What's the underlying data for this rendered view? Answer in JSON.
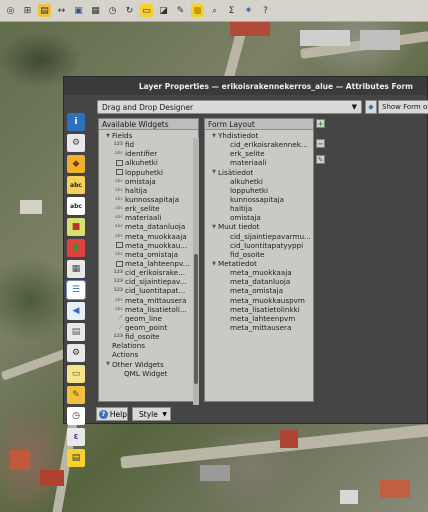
{
  "dialog": {
    "title": "Layer Properties — erikoisrakennekerros_alue — Attributes Form",
    "designer_mode": "Drag and Drop Designer",
    "show_form_label": "Show Form on",
    "help_label": "Help",
    "style_label": "Style"
  },
  "available_widgets": {
    "header": "Available Widgets",
    "rows": [
      {
        "kind": "group",
        "label": "Fields",
        "indent": 1
      },
      {
        "kind": "int",
        "label": "fid",
        "indent": 2
      },
      {
        "kind": "str",
        "label": "identifier",
        "indent": 2
      },
      {
        "kind": "date",
        "label": "alkuhetki",
        "indent": 2
      },
      {
        "kind": "date",
        "label": "loppuhetki",
        "indent": 2
      },
      {
        "kind": "str",
        "label": "omistaja",
        "indent": 2
      },
      {
        "kind": "str",
        "label": "haltija",
        "indent": 2
      },
      {
        "kind": "str",
        "label": "kunnossapitaja",
        "indent": 2
      },
      {
        "kind": "str",
        "label": "erk_selite",
        "indent": 2
      },
      {
        "kind": "str",
        "label": "materiaali",
        "indent": 2
      },
      {
        "kind": "str",
        "label": "meta_datanluoja",
        "indent": 2
      },
      {
        "kind": "str",
        "label": "meta_muokkaaja",
        "indent": 2
      },
      {
        "kind": "date",
        "label": "meta_muokkau...",
        "indent": 2
      },
      {
        "kind": "str",
        "label": "meta_omistaja",
        "indent": 2
      },
      {
        "kind": "date",
        "label": "meta_lahteenpv...",
        "indent": 2
      },
      {
        "kind": "int",
        "label": "cid_erikoisrake...",
        "indent": 2
      },
      {
        "kind": "int",
        "label": "cid_sijaintiepav...",
        "indent": 2
      },
      {
        "kind": "int",
        "label": "cid_luontitapat...",
        "indent": 2
      },
      {
        "kind": "str",
        "label": "meta_mittausera",
        "indent": 2
      },
      {
        "kind": "str",
        "label": "meta_lisatietoli...",
        "indent": 2
      },
      {
        "kind": "geom",
        "label": "geom_line",
        "indent": 2
      },
      {
        "kind": "geom",
        "label": "geom_point",
        "indent": 2
      },
      {
        "kind": "int",
        "label": "fid_osoite",
        "indent": 2
      },
      {
        "kind": "plain",
        "label": "Relations",
        "indent": 1
      },
      {
        "kind": "plain",
        "label": "Actions",
        "indent": 1
      },
      {
        "kind": "group",
        "label": "Other Widgets",
        "indent": 1
      },
      {
        "kind": "plain",
        "label": "QML Widget",
        "indent": 2
      }
    ]
  },
  "form_layout": {
    "header": "Form Layout",
    "rows": [
      {
        "kind": "group",
        "label": "Yhdistiedot",
        "indent": 1
      },
      {
        "kind": "plain",
        "label": "cid_erikoisrakennek...",
        "indent": 2
      },
      {
        "kind": "plain",
        "label": "erk_selite",
        "indent": 2
      },
      {
        "kind": "plain",
        "label": "materiaali",
        "indent": 2
      },
      {
        "kind": "group",
        "label": "Lisätiedot",
        "indent": 1
      },
      {
        "kind": "plain",
        "label": "alkuhetki",
        "indent": 2
      },
      {
        "kind": "plain",
        "label": "loppuhetki",
        "indent": 2
      },
      {
        "kind": "plain",
        "label": "kunnossapitaja",
        "indent": 2
      },
      {
        "kind": "plain",
        "label": "haltija",
        "indent": 2
      },
      {
        "kind": "plain",
        "label": "omistaja",
        "indent": 2
      },
      {
        "kind": "group",
        "label": "Muut tiedot",
        "indent": 1
      },
      {
        "kind": "plain",
        "label": "cid_sijaintiepavarmu...",
        "indent": 2
      },
      {
        "kind": "plain",
        "label": "cid_luontitapatyyppi",
        "indent": 2
      },
      {
        "kind": "plain",
        "label": "fid_osoite",
        "indent": 2
      },
      {
        "kind": "group",
        "label": "Metatiedot",
        "indent": 1
      },
      {
        "kind": "plain",
        "label": "meta_muokkaaja",
        "indent": 2
      },
      {
        "kind": "plain",
        "label": "meta_datanluoja",
        "indent": 2
      },
      {
        "kind": "plain",
        "label": "meta_omistaja",
        "indent": 2
      },
      {
        "kind": "plain",
        "label": "meta_muokkauspvm",
        "indent": 2
      },
      {
        "kind": "plain",
        "label": "meta_lisatietolinkki",
        "indent": 2
      },
      {
        "kind": "plain",
        "label": "meta_lahteenpvm",
        "indent": 2
      },
      {
        "kind": "plain",
        "label": "meta_mittausera",
        "indent": 2
      }
    ]
  },
  "side_icons": [
    {
      "name": "information-icon",
      "glyph": "i",
      "bg": "#2f6fbf",
      "fg": "#ffffff"
    },
    {
      "name": "source-icon",
      "glyph": "⚙",
      "bg": "#e8e8e8",
      "fg": "#444444"
    },
    {
      "name": "symbology-icon",
      "glyph": "◆",
      "bg": "#f0b030",
      "fg": "#7a3d00"
    },
    {
      "name": "labels-icon",
      "glyph": "abc",
      "bg": "#f5d05a",
      "fg": "#222222"
    },
    {
      "name": "masks-icon",
      "glyph": "abc",
      "bg": "#ffffff",
      "fg": "#222222"
    },
    {
      "name": "3d-view-icon",
      "glyph": "■",
      "bg": "#d8e070",
      "fg": "#c03030"
    },
    {
      "name": "diagrams-icon",
      "glyph": "▮",
      "bg": "#e04040",
      "fg": "#2a9a2a"
    },
    {
      "name": "fields-icon",
      "glyph": "▦",
      "bg": "#e8e8e8",
      "fg": "#444444"
    },
    {
      "name": "attributes-form-icon",
      "glyph": "☰",
      "bg": "#ffffff",
      "fg": "#2f6fbf"
    },
    {
      "name": "joins-icon",
      "glyph": "◀",
      "bg": "#e8eef8",
      "fg": "#2f6fbf"
    },
    {
      "name": "auxiliary-storage-icon",
      "glyph": "▤",
      "bg": "#e8e8e8",
      "fg": "#555555"
    },
    {
      "name": "actions-icon",
      "glyph": "⚙",
      "bg": "#e8e8e8",
      "fg": "#333333"
    },
    {
      "name": "display-icon",
      "glyph": "▭",
      "bg": "#f5e48a",
      "fg": "#555555"
    },
    {
      "name": "rendering-icon",
      "glyph": "✎",
      "bg": "#f0c040",
      "fg": "#6a4a00"
    },
    {
      "name": "temporal-icon",
      "glyph": "◷",
      "bg": "#ffffff",
      "fg": "#333333"
    },
    {
      "name": "variables-icon",
      "glyph": "ε",
      "bg": "#e8e8e8",
      "fg": "#6a3ea0"
    },
    {
      "name": "metadata-icon",
      "glyph": "▤",
      "bg": "#f5d030",
      "fg": "#333333"
    }
  ],
  "toolbar_icons": [
    {
      "name": "identify-icon",
      "glyph": "◎",
      "bg": "#d6d3cd",
      "fg": "#333333"
    },
    {
      "name": "measure-icon",
      "glyph": "⊞",
      "bg": "#d6d3cd",
      "fg": "#333333"
    },
    {
      "name": "layer-icon",
      "glyph": "▤",
      "bg": "#f0c040",
      "fg": "#333333"
    },
    {
      "name": "pan-icon",
      "glyph": "↔",
      "bg": "#d6d3cd",
      "fg": "#333333"
    },
    {
      "name": "save-icon",
      "glyph": "▣",
      "bg": "#d6d3cd",
      "fg": "#2f4f8f"
    },
    {
      "name": "grid-icon",
      "glyph": "▦",
      "bg": "#d6d3cd",
      "fg": "#333333"
    },
    {
      "name": "clock-icon",
      "glyph": "◷",
      "bg": "#d6d3cd",
      "fg": "#333333"
    },
    {
      "name": "refresh-icon",
      "glyph": "↻",
      "bg": "#d6d3cd",
      "fg": "#333333"
    },
    {
      "name": "select-icon",
      "glyph": "▭",
      "bg": "#f5d030",
      "fg": "#333333"
    },
    {
      "name": "deselect-icon",
      "glyph": "◪",
      "bg": "#d6d3cd",
      "fg": "#333333"
    },
    {
      "name": "pencil-icon",
      "glyph": "✎",
      "bg": "#d6d3cd",
      "fg": "#333333"
    },
    {
      "name": "box-icon",
      "glyph": "■",
      "bg": "#f5d030",
      "fg": "#c0a000"
    },
    {
      "name": "zoom-icon",
      "glyph": "⌕",
      "bg": "#d6d3cd",
      "fg": "#333333"
    },
    {
      "name": "sigma-icon",
      "glyph": "Σ",
      "bg": "#d6d3cd",
      "fg": "#333333"
    },
    {
      "name": "settings-icon",
      "glyph": "✷",
      "bg": "#d6d3cd",
      "fg": "#2f6fbf"
    },
    {
      "name": "help-icon",
      "glyph": "?",
      "bg": "#d6d3cd",
      "fg": "#333333"
    }
  ]
}
